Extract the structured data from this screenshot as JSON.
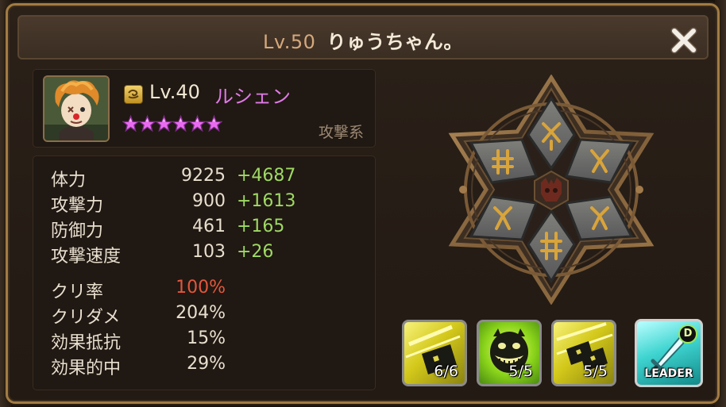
{
  "header": {
    "level": "Lv.50",
    "name": "りゅうちゃん。"
  },
  "monster": {
    "level": "Lv.40",
    "name": "ルシェン",
    "type": "攻撃系",
    "stars": 6,
    "element_icon": "wind-element-icon"
  },
  "stats": [
    {
      "label": "体力",
      "base": "9225",
      "bonus": "+4687"
    },
    {
      "label": "攻撃力",
      "base": "900",
      "bonus": "+1613"
    },
    {
      "label": "防御力",
      "base": "461",
      "bonus": "+165"
    },
    {
      "label": "攻撃速度",
      "base": "103",
      "bonus": "+26"
    },
    {
      "label": "クリ率",
      "base": "100%",
      "bonus": ""
    },
    {
      "label": "クリダメ",
      "base": "204%",
      "bonus": ""
    },
    {
      "label": "効果抵抗",
      "base": "15%",
      "bonus": ""
    },
    {
      "label": "効果的中",
      "base": "29%",
      "bonus": ""
    }
  ],
  "runes": {
    "center_icon": "demon-skull-icon",
    "slots": [
      "rune-slot-1",
      "rune-slot-2",
      "rune-slot-3",
      "rune-slot-4",
      "rune-slot-5",
      "rune-slot-6"
    ]
  },
  "skills": [
    {
      "name": "skill-1",
      "icon": "card-throw-icon",
      "level": "6/6"
    },
    {
      "name": "skill-2",
      "icon": "grinning-mask-icon",
      "level": "5/5"
    },
    {
      "name": "skill-3",
      "icon": "cards-fan-icon",
      "level": "5/5"
    },
    {
      "name": "leader-skill",
      "icon": "sword-icon",
      "label": "LEADER",
      "badge": "D"
    }
  ],
  "colors": {
    "accent_gold": "#a27c43",
    "bonus_green": "#9ed964",
    "crit_red": "#e2573c",
    "name_pink": "#e07ae8"
  }
}
